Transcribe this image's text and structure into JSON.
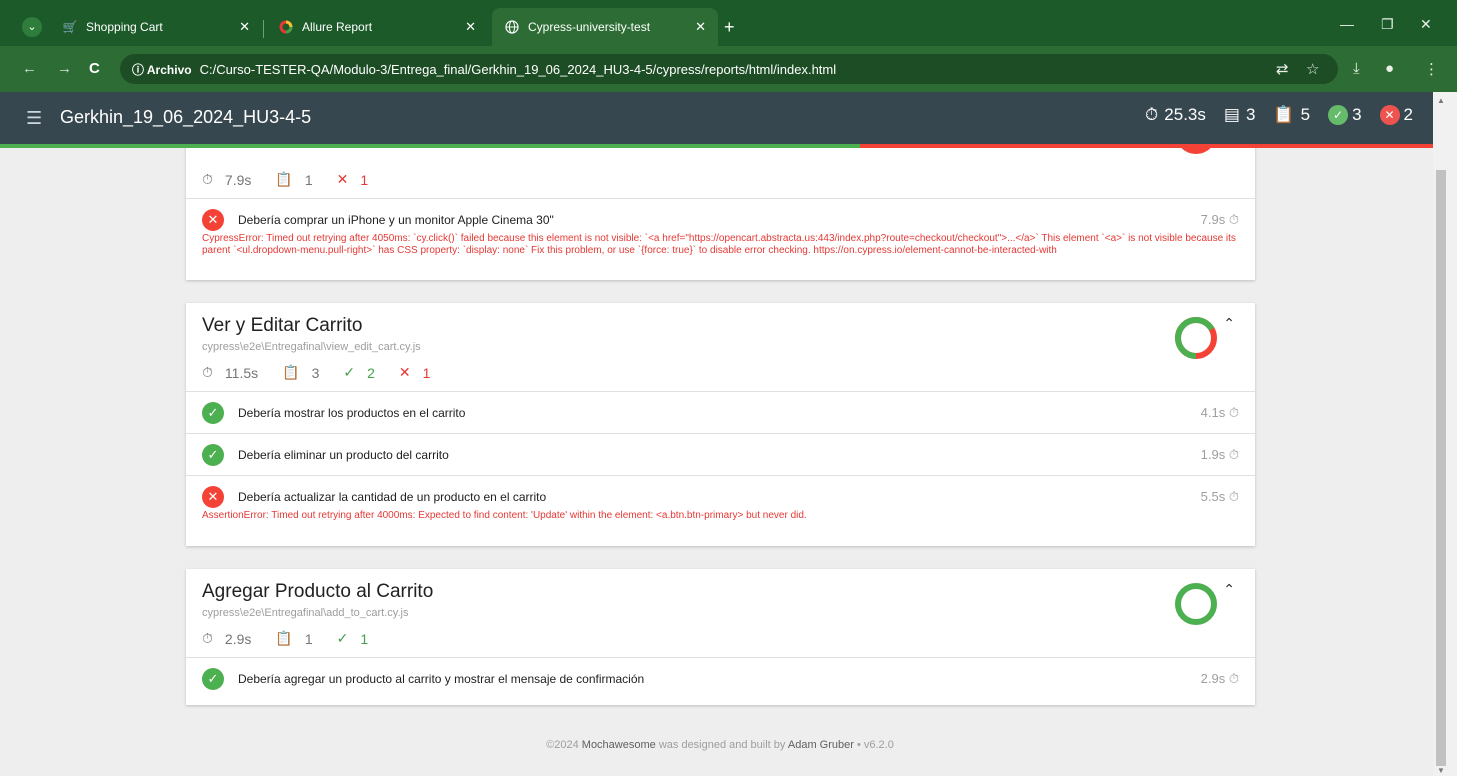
{
  "browser": {
    "tabs": [
      {
        "title": "Shopping Cart",
        "icon": "cart-icon"
      },
      {
        "title": "Allure Report",
        "icon": "allure-icon"
      },
      {
        "title": "Cypress-university-test",
        "icon": "globe-icon",
        "active": true
      }
    ],
    "omnibox": {
      "chip": "Archivo",
      "url": "C:/Curso-TESTER-QA/Modulo-3/Entrega_final/Gerkhin_19_06_2024_HU3-4-5/cypress/reports/html/index.html"
    }
  },
  "appbar": {
    "title": "Gerkhin_19_06_2024_HU3-4-5",
    "duration": "25.3s",
    "suites": "3",
    "tests": "5",
    "passed": "3",
    "failed": "2"
  },
  "progress": {
    "passed_fraction": 0.6,
    "failed_fraction": 0.4
  },
  "suites": [
    {
      "title": "",
      "file": "",
      "duration": "7.9s",
      "tests_count": "1",
      "passed": "",
      "failed": "1",
      "tests": [
        {
          "title": "Debería comprar un iPhone y un monitor Apple Cinema 30\"",
          "duration": "7.9s",
          "state": "fail",
          "error": "CypressError: Timed out retrying after 4050ms: `cy.click()` failed because this element is not visible: `<a href=\"https://opencart.abstracta.us:443/index.php?route=checkout/checkout\">...</a>` This element `<a>` is not visible because its parent `<ul.dropdown-menu.pull-right>` has CSS property: `display: none` Fix this problem, or use `{force: true}` to disable error checking. https://on.cypress.io/element-cannot-be-interacted-with"
        }
      ]
    },
    {
      "title": "Ver y Editar Carrito",
      "file": "cypress\\e2e\\Entregafinal\\view_edit_cart.cy.js",
      "duration": "11.5s",
      "tests_count": "3",
      "passed": "2",
      "failed": "1",
      "pass_fraction": 0.667,
      "tests": [
        {
          "title": "Debería mostrar los productos en el carrito",
          "duration": "4.1s",
          "state": "pass"
        },
        {
          "title": "Debería eliminar un producto del carrito",
          "duration": "1.9s",
          "state": "pass"
        },
        {
          "title": "Debería actualizar la cantidad de un producto en el carrito",
          "duration": "5.5s",
          "state": "fail",
          "error": "AssertionError: Timed out retrying after 4000ms: Expected to find content: 'Update' within the element: <a.btn.btn-primary> but never did."
        }
      ]
    },
    {
      "title": "Agregar Producto al Carrito",
      "file": "cypress\\e2e\\Entregafinal\\add_to_cart.cy.js",
      "duration": "2.9s",
      "tests_count": "1",
      "passed": "1",
      "failed": "",
      "pass_fraction": 1.0,
      "tests": [
        {
          "title": "Debería agregar un producto al carrito y mostrar el mensaje de confirmación",
          "duration": "2.9s",
          "state": "pass"
        }
      ]
    }
  ],
  "footer": {
    "prefix": "©2024",
    "brand": "Mochawesome",
    "middle": "was designed and built by",
    "author": "Adam Gruber",
    "version": "• v6.2.0"
  },
  "colors": {
    "pass": "#4caf50",
    "fail": "#f44336",
    "appbar": "#37474f",
    "browser": "#2d6d35"
  }
}
